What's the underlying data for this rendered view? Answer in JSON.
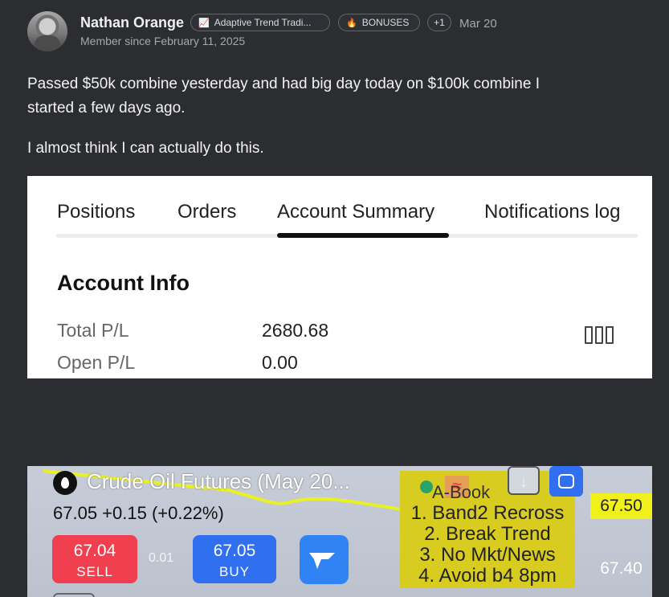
{
  "post": {
    "author": "Nathan Orange",
    "member_since": "Member since February 11, 2025",
    "badges": [
      {
        "label": "Adaptive Trend Tradi...",
        "icon": "chart-icon"
      },
      {
        "label": "BONUSES",
        "icon": "flame-icon"
      },
      {
        "label": "+1"
      }
    ],
    "date": "Mar 20",
    "lines": [
      "Passed $50k combine yesterday and had big day today on $100k combine I",
      "started a few days ago.",
      "I almost think I can actually do this."
    ]
  },
  "account_panel": {
    "tabs": [
      "Positions",
      "Orders",
      "Account Summary",
      "Notifications log"
    ],
    "active_tab": "Account Summary",
    "section_title": "Account Info",
    "rows": [
      {
        "label": "Total P/L",
        "value": "2680.68"
      },
      {
        "label": "Open P/L",
        "value": "0.00"
      }
    ],
    "columns_icon": "columns-icon"
  },
  "chart_panel": {
    "instrument": "Crude Oil Futures (May 20...",
    "price_line": "67.05 +0.15 (+0.22%)",
    "sell": {
      "price": "67.04",
      "label": "SELL"
    },
    "buy": {
      "price": "67.05",
      "label": "BUY"
    },
    "spread": "0.01",
    "note": {
      "header": "A-Book",
      "items": [
        "1. Band2 Recross",
        "2. Break Trend",
        "3. No Mkt/News",
        "4. Avoid b4 8pm"
      ]
    },
    "axis_labels": [
      "67.50",
      "67.40"
    ],
    "colors": {
      "sell": "#f0404f",
      "buy": "#2f6ff0",
      "note": "#d8cc21",
      "highlight": "#f0f01a"
    }
  }
}
